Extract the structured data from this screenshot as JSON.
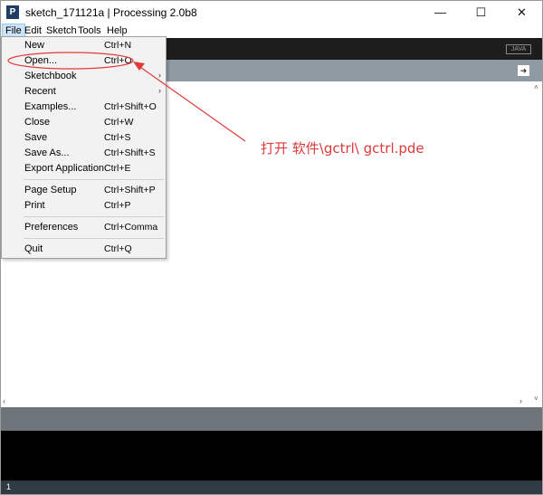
{
  "window": {
    "app_icon": "P",
    "title": "sketch_171121a | Processing 2.0b8",
    "minimize_icon": "—",
    "maximize_icon": "☐",
    "close_icon": "✕"
  },
  "menubar": {
    "items": [
      "File",
      "Edit",
      "Sketch",
      "Tools",
      "Help"
    ]
  },
  "toolbar": {
    "mode_label": "JAVA"
  },
  "tabbar": {
    "tab_menu_icon": "➜"
  },
  "file_menu": {
    "items": [
      {
        "label": "New",
        "shortcut": "Ctrl+N"
      },
      {
        "label": "Open...",
        "shortcut": "Ctrl+O"
      },
      {
        "label": "Sketchbook",
        "shortcut": "",
        "submenu": "›"
      },
      {
        "label": "Recent",
        "shortcut": "",
        "submenu": "›"
      },
      {
        "label": "Examples...",
        "shortcut": "Ctrl+Shift+O"
      },
      {
        "label": "Close",
        "shortcut": "Ctrl+W"
      },
      {
        "label": "Save",
        "shortcut": "Ctrl+S"
      },
      {
        "label": "Save As...",
        "shortcut": "Ctrl+Shift+S"
      },
      {
        "label": "Export Application",
        "shortcut": "Ctrl+E"
      },
      {
        "label": "Page Setup",
        "shortcut": "Ctrl+Shift+P"
      },
      {
        "label": "Print",
        "shortcut": "Ctrl+P"
      },
      {
        "label": "Preferences",
        "shortcut": "Ctrl+Comma"
      },
      {
        "label": "Quit",
        "shortcut": "Ctrl+Q"
      }
    ]
  },
  "annotation": {
    "text": "打开 软件\\gctrl\\ gctrl.pde",
    "color": "#e03a3a"
  },
  "statusbar": {
    "line_number": "1"
  },
  "scroll": {
    "up": "˄",
    "down": "˅",
    "left": "‹",
    "right": "›"
  }
}
